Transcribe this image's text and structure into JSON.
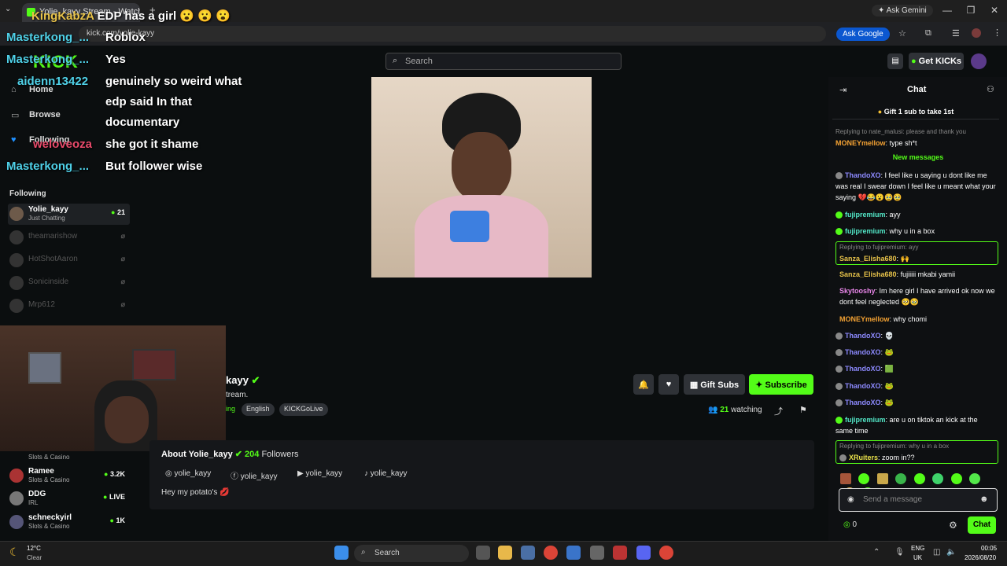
{
  "browser": {
    "tab_title": "Yolie_kayy Stream - Watch...",
    "url": "kick.com/yolie-kayy",
    "ask_gemini": "Ask Gemini",
    "ask_google": "Ask Google"
  },
  "header": {
    "search_placeholder": "Search",
    "get_kicks": "Get KICKs"
  },
  "nav": {
    "home": "Home",
    "browse": "Browse",
    "following": "Following",
    "section": "Following"
  },
  "following": [
    {
      "name": "Yolie_kayy",
      "sub": "Just Chatting",
      "count": "21",
      "live": true
    },
    {
      "name": "theamarishow",
      "sub": "",
      "count": "",
      "live": false
    },
    {
      "name": "HotShotAaron",
      "sub": "",
      "count": "",
      "live": false
    },
    {
      "name": "Sonicinside",
      "sub": "",
      "count": "",
      "live": false
    },
    {
      "name": "Mrp612",
      "sub": "",
      "count": "",
      "live": false
    }
  ],
  "recommended": [
    {
      "name": "Slots & Casino",
      "sub": "",
      "count": ""
    },
    {
      "name": "Ramee",
      "sub": "Slots & Casino",
      "count": "3.2K"
    },
    {
      "name": "DDG",
      "sub": "IRL",
      "count": "LIVE"
    },
    {
      "name": "schneckyirl",
      "sub": "Slots & Casino",
      "count": "1K"
    }
  ],
  "overlay_chat": [
    {
      "user": "KingKabzA",
      "text": "EDP has a girl 😮 😮 😮",
      "color": "#e8c34a"
    },
    {
      "user": "Masterkong_...",
      "text": "Roblox",
      "color": "#4fd1e8"
    },
    {
      "user": "Masterkong_...",
      "text": "Yes",
      "color": "#4fd1e8"
    },
    {
      "user": "aidenn13422",
      "text": "genuinely so weird what",
      "color": "#4fd1e8"
    },
    {
      "user": "",
      "text": "edp said In that",
      "color": "#fff"
    },
    {
      "user": "",
      "text": "documentary",
      "color": "#fff"
    },
    {
      "user": "weloveoza",
      "text": "she got it shame",
      "color": "#e84a6a"
    },
    {
      "user": "Masterkong_...",
      "text": "But follower wise",
      "color": "#4fd1e8"
    }
  ],
  "channel": {
    "name_partial": "kayy",
    "desc_partial": "tream.",
    "tag_partial": "ing",
    "tags": [
      "English",
      "KICKGoLive"
    ],
    "gift_subs": "Gift Subs",
    "subscribe": "Subscribe",
    "watching_count": "21",
    "watching_label": "watching"
  },
  "about": {
    "title": "About Yolie_kayy",
    "followers_count": "204",
    "followers_label": "Followers",
    "socials": [
      "yolie_kayy",
      "yolie_kayy",
      "yolie_kayy",
      "yolie_kayy"
    ],
    "bio": "Hey my potato's 💋"
  },
  "chat": {
    "title": "Chat",
    "gift_banner": "Gift 1 sub to take 1st",
    "new_messages": "New messages",
    "input_placeholder": "Send a message",
    "points": "0",
    "send": "Chat",
    "messages": [
      {
        "reply": "Replying to nate_malusi: please and thank you",
        "user": "MONEYmellow",
        "color": "#f4a233",
        "text": "type sh*t"
      },
      {
        "reply": "",
        "user": "ThandoXO",
        "color": "#8d8aff",
        "text": "I feel like u saying u dont like me was real I swear down I feel like u meant what your saying 💔😂😮🥹🥹"
      },
      {
        "reply": "",
        "user": "fujipremium",
        "color": "#53e8c8",
        "text": "ayy"
      },
      {
        "reply": "",
        "user": "fujipremium",
        "color": "#53e8c8",
        "text": "why u in a box"
      },
      {
        "reply": "Replying to fujipremium: ayy",
        "user": "Sanza_Elisha680",
        "color": "#e8c34a",
        "text": "🙌"
      },
      {
        "reply": "",
        "user": "Sanza_Elisha680",
        "color": "#e8c34a",
        "text": "fujiiiii mkabi yamii"
      },
      {
        "reply": "",
        "user": "Skytooshy",
        "color": "#e885e8",
        "text": "Im here girl I have arrived ok now we dont feel neglected 🥺🥹"
      },
      {
        "reply": "",
        "user": "MONEYmellow",
        "color": "#f4a233",
        "text": "why chomi"
      },
      {
        "reply": "",
        "user": "ThandoXO",
        "color": "#8d8aff",
        "text": "💀"
      },
      {
        "reply": "",
        "user": "ThandoXO",
        "color": "#8d8aff",
        "text": "🐸"
      },
      {
        "reply": "",
        "user": "ThandoXO",
        "color": "#8d8aff",
        "text": "🟩"
      },
      {
        "reply": "",
        "user": "ThandoXO",
        "color": "#8d8aff",
        "text": "🐸"
      },
      {
        "reply": "",
        "user": "ThandoXO",
        "color": "#8d8aff",
        "text": "🐸"
      },
      {
        "reply": "",
        "user": "fujipremium",
        "color": "#53e8c8",
        "text": "are u on tiktok an kick at the same time"
      },
      {
        "reply": "Replying to fujipremium: why u in a box",
        "user": "XRuiters",
        "color": "#e8e04a",
        "text": "zoom in??"
      }
    ]
  },
  "taskbar": {
    "weather_temp": "12°C",
    "weather_desc": "Clear",
    "search": "Search",
    "lang": "ENG",
    "region": "UK",
    "time": "00:05",
    "date": "2026/08/20"
  },
  "colors": {
    "accent": "#53fc18",
    "bg": "#0b0e0f"
  }
}
